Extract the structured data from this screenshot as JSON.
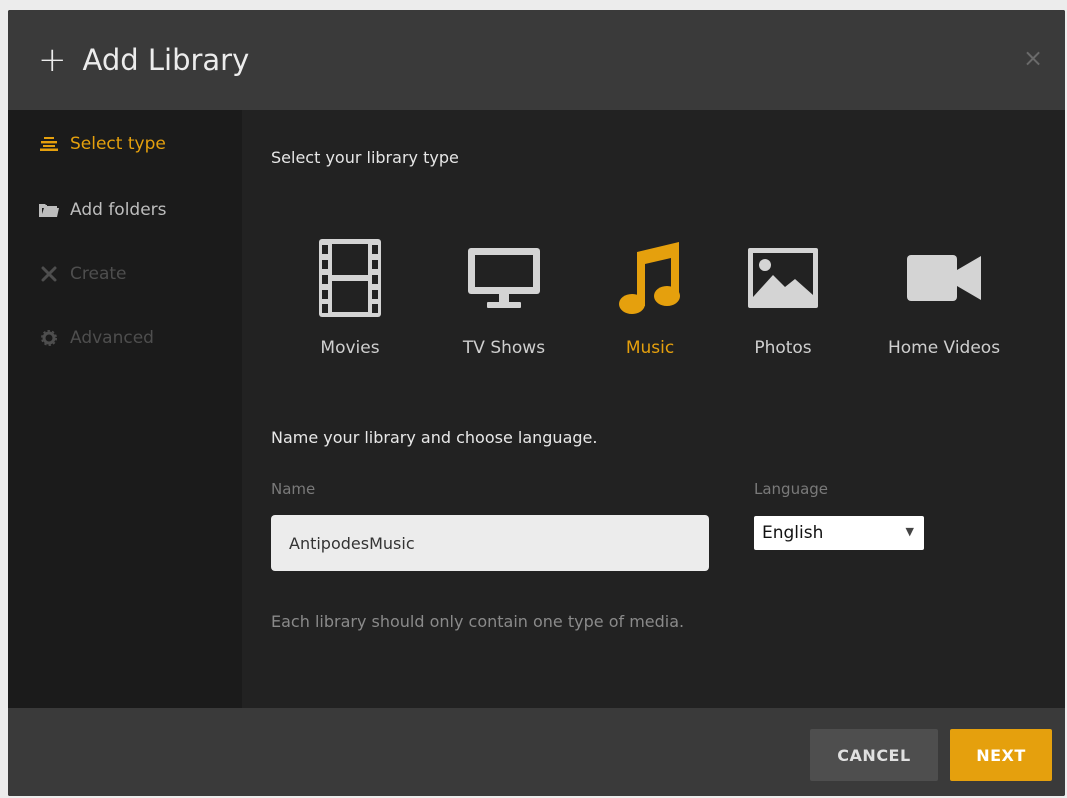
{
  "header": {
    "title": "Add Library",
    "plus_glyph": "+",
    "close_glyph": "×",
    "icons": {
      "add": "plus-icon",
      "close": "close-icon"
    }
  },
  "sidebar": {
    "items": [
      {
        "label": "Select type",
        "icon": "stack-icon",
        "state": "active"
      },
      {
        "label": "Add folders",
        "icon": "folder-icon",
        "state": "enabled"
      },
      {
        "label": "Create",
        "icon": "tools-icon",
        "state": "disabled"
      },
      {
        "label": "Advanced",
        "icon": "gear-icon",
        "state": "disabled"
      }
    ]
  },
  "main": {
    "heading": "Select your library type",
    "types": [
      {
        "label": "Movies",
        "icon": "film-icon"
      },
      {
        "label": "TV Shows",
        "icon": "monitor-icon"
      },
      {
        "label": "Music",
        "icon": "music-note-icon",
        "selected": true
      },
      {
        "label": "Photos",
        "icon": "image-icon"
      },
      {
        "label": "Home Videos",
        "icon": "video-camera-icon"
      }
    ],
    "name_section_heading": "Name your library and choose language.",
    "name_label": "Name",
    "name_value": "AntipodesMusic",
    "language_label": "Language",
    "language_value": "English",
    "note": "Each library should only contain one type of media."
  },
  "footer": {
    "cancel_label": "CANCEL",
    "next_label": "NEXT"
  },
  "colors": {
    "accent": "#e5a00d",
    "background": "#222222",
    "header": "#3a3a3a",
    "sidebar": "#1b1b1b"
  }
}
